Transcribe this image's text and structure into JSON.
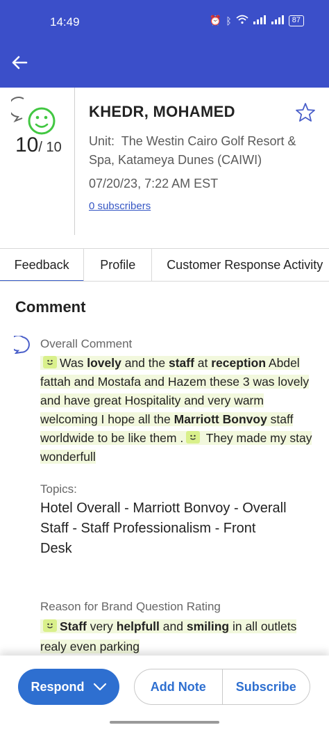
{
  "status_bar": {
    "time": "14:49",
    "battery": "87"
  },
  "header": {
    "score": "10",
    "score_max": "/ 10",
    "guest_name": "KHEDR, MOHAMED",
    "unit_prefix": "Unit:",
    "unit": "The Westin Cairo Golf Resort & Spa, Katameya Dunes (CAIWI)",
    "date": "07/20/23, 7:22 AM EST",
    "subscribers": "0 subscribers"
  },
  "tabs": [
    {
      "label": "Feedback",
      "active": true
    },
    {
      "label": "Profile",
      "active": false
    },
    {
      "label": "Customer Response Activity",
      "active": false
    }
  ],
  "comment": {
    "section_title": "Comment",
    "overall_label": "Overall Comment",
    "segments": [
      "Was ",
      "lovely",
      " and the ",
      "staff",
      " at ",
      "reception",
      " Abdel fattah and Mostafa and Hazem these 3 was lovely and have great Hospitality and very warm welcoming I hope all the ",
      "Marriott Bonvoy",
      " staff worldwide to be like them .",
      "They made my stay wonderfull"
    ],
    "topics_label": "Topics:",
    "topics": [
      "Hotel Overall - Marriott Bonvoy - Overall",
      "Staff - Staff Professionalism - Front Desk"
    ],
    "reason_label": "Reason for Brand Question Rating",
    "reason_segments": [
      "Staff",
      " very ",
      "helpfull",
      " and ",
      "smiling",
      " in all outlets realy even parking"
    ]
  },
  "actions": {
    "respond": "Respond",
    "add_note": "Add Note",
    "subscribe": "Subscribe"
  },
  "colors": {
    "app_bar": "#3b4fc9",
    "accent": "#2e6fd0",
    "highlight": "#f2f8dd",
    "smiley": "#42c742"
  }
}
